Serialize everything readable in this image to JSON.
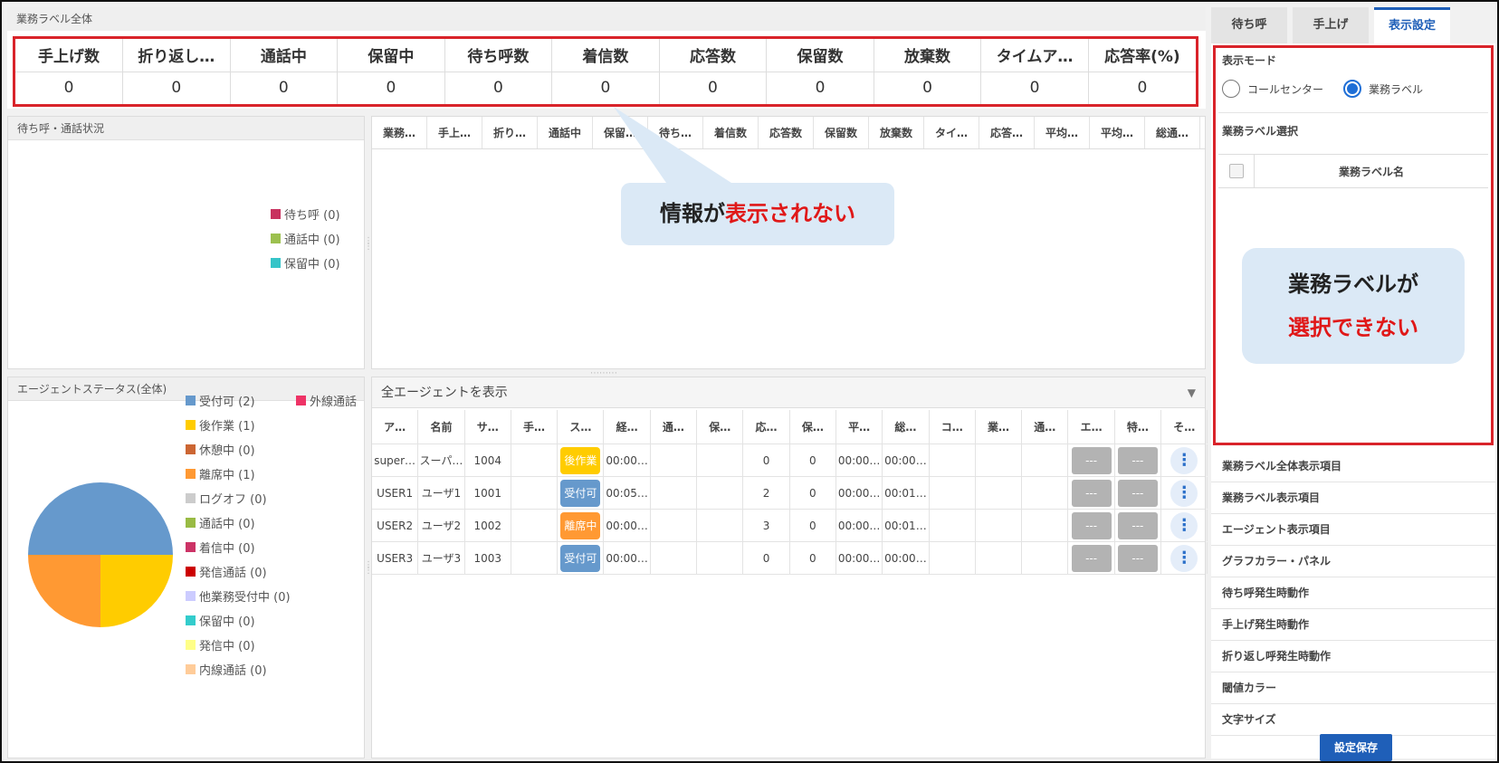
{
  "summary": {
    "title": "業務ラベル全体",
    "headers": [
      "手上げ数",
      "折り返し…",
      "通話中",
      "保留中",
      "待ち呼数",
      "着信数",
      "応答数",
      "保留数",
      "放棄数",
      "タイムア…",
      "応答率(%)"
    ],
    "values": [
      "0",
      "0",
      "0",
      "0",
      "0",
      "0",
      "0",
      "0",
      "0",
      "0",
      "0"
    ]
  },
  "queue": {
    "title": "待ち呼・通話状況",
    "legend": [
      {
        "label": "待ち呼 (0)",
        "color": "#c8325f"
      },
      {
        "label": "通話中 (0)",
        "color": "#9cc04f"
      },
      {
        "label": "保留中 (0)",
        "color": "#36c4c8"
      }
    ]
  },
  "center": {
    "headers": [
      "業務…",
      "手上…",
      "折り…",
      "通話中",
      "保留…",
      "待ち…",
      "着信数",
      "応答数",
      "保留数",
      "放棄数",
      "タイ…",
      "応答…",
      "平均…",
      "平均…",
      "総通…"
    ],
    "callout_prefix": "情報が",
    "callout_red": "表示されない"
  },
  "agentstatus": {
    "title": "エージェントステータス(全体)",
    "legend_left": [
      {
        "label": "受付可 (2)",
        "color": "#6699cc"
      },
      {
        "label": "後作業 (1)",
        "color": "#ffcc00"
      },
      {
        "label": "休憩中 (0)",
        "color": "#cc6633"
      },
      {
        "label": "離席中 (1)",
        "color": "#ff9933"
      },
      {
        "label": "ログオフ (0)",
        "color": "#cccccc"
      },
      {
        "label": "通話中 (0)",
        "color": "#99bb44"
      },
      {
        "label": "着信中 (0)",
        "color": "#cc3366"
      },
      {
        "label": "発信通話 (0)",
        "color": "#cc0000"
      },
      {
        "label": "他業務受付中 (0)",
        "color": "#ccccff"
      },
      {
        "label": "保留中 (0)",
        "color": "#33cccc"
      },
      {
        "label": "発信中 (0)",
        "color": "#ffff88"
      },
      {
        "label": "内線通話 (0)",
        "color": "#ffcc99"
      }
    ],
    "legend_right": {
      "label": "外線通話",
      "color": "#ee3366"
    },
    "pie": [
      {
        "name": "受付可",
        "value": 2,
        "color": "#6699cc"
      },
      {
        "name": "後作業",
        "value": 1,
        "color": "#ffcc00"
      },
      {
        "name": "離席中",
        "value": 1,
        "color": "#ff9933"
      }
    ]
  },
  "agents": {
    "filter_label": "全エージェントを表示",
    "headers": [
      "ア…",
      "名前",
      "サ…",
      "手…",
      "ス…",
      "経…",
      "通…",
      "保…",
      "応…",
      "保…",
      "平…",
      "総…",
      "コ…",
      "業…",
      "通…",
      "エ…",
      "特…",
      "そ…"
    ],
    "rows": [
      {
        "id": "super…",
        "name": "スーパ…",
        "ext": "1004",
        "status": "後作業",
        "status_color": "#ffcc00",
        "elapsed": "00:00…",
        "answered": "0",
        "hold": "0",
        "avg": "00:00…",
        "total": "00:00…"
      },
      {
        "id": "USER1",
        "name": "ユーザ1",
        "ext": "1001",
        "status": "受付可",
        "status_color": "#6699cc",
        "elapsed": "00:05…",
        "answered": "2",
        "hold": "0",
        "avg": "00:00…",
        "total": "00:01…"
      },
      {
        "id": "USER2",
        "name": "ユーザ2",
        "ext": "1002",
        "status": "離席中",
        "status_color": "#ff9933",
        "elapsed": "00:00…",
        "answered": "3",
        "hold": "0",
        "avg": "00:00…",
        "total": "00:01…"
      },
      {
        "id": "USER3",
        "name": "ユーザ3",
        "ext": "1003",
        "status": "受付可",
        "status_color": "#6699cc",
        "elapsed": "00:00…",
        "answered": "0",
        "hold": "0",
        "avg": "00:00…",
        "total": "00:00…"
      }
    ],
    "btn_label": "---"
  },
  "right": {
    "tabs": [
      "待ち呼",
      "手上げ",
      "表示設定"
    ],
    "display_mode_label": "表示モード",
    "radio_callcenter": "コールセンター",
    "radio_label": "業務ラベル",
    "select_label": "業務ラベル選択",
    "col_name": "業務ラベル名",
    "callout_line1": "業務ラベルが",
    "callout_line2": "選択できない",
    "menu": [
      "業務ラベル全体表示項目",
      "業務ラベル表示項目",
      "エージェント表示項目",
      "グラフカラー・パネル",
      "待ち呼発生時動作",
      "手上げ発生時動作",
      "折り返し呼発生時動作",
      "閾値カラー",
      "文字サイズ"
    ],
    "save_label": "設定保存"
  }
}
